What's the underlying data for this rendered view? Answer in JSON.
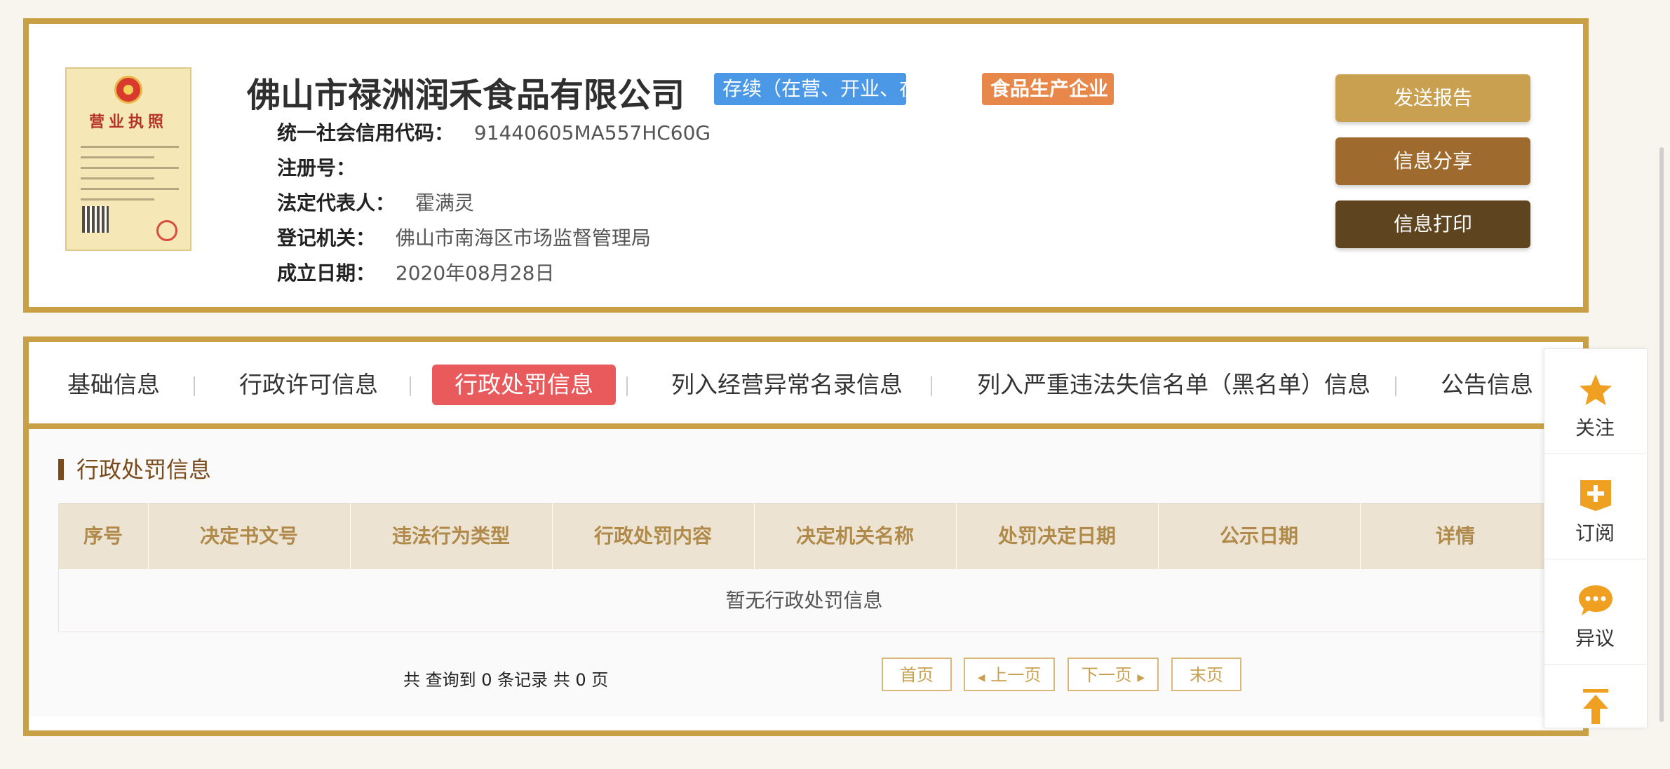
{
  "company": {
    "name": "佛山市禄洲润禾食品有限公司",
    "status_badge": "存续（在营、开业、在册）",
    "type_badge": "食品生产企业",
    "license_title": "营业执照",
    "fields": [
      {
        "label": "统一社会信用代码：",
        "value": "91440605MA557HC60G"
      },
      {
        "label": "注册号：",
        "value": ""
      },
      {
        "label": "法定代表人：",
        "value": "霍满灵"
      },
      {
        "label": "登记机关：",
        "value": "佛山市南海区市场监督管理局"
      },
      {
        "label": "成立日期：",
        "value": "2020年08月28日"
      }
    ]
  },
  "actions": {
    "send_report": "发送报告",
    "share": "信息分享",
    "print": "信息打印"
  },
  "tabs": [
    {
      "label": "基础信息",
      "active": false
    },
    {
      "label": "行政许可信息",
      "active": false
    },
    {
      "label": "行政处罚信息",
      "active": true
    },
    {
      "label": "列入经营异常名录信息",
      "active": false
    },
    {
      "label": "列入严重违法失信名单（黑名单）信息",
      "active": false
    },
    {
      "label": "公告信息",
      "active": false
    }
  ],
  "section": {
    "title": "行政处罚信息",
    "columns": [
      "序号",
      "决定书文号",
      "违法行为类型",
      "行政处罚内容",
      "决定机关名称",
      "处罚决定日期",
      "公示日期",
      "详情"
    ],
    "empty_text": "暂无行政处罚信息"
  },
  "pagination": {
    "summary": "共 查询到 0 条记录 共 0 页",
    "first": "首页",
    "prev": "上一页",
    "next": "下一页",
    "last": "末页"
  },
  "sidebar": [
    {
      "label": "关注",
      "icon": "star-icon"
    },
    {
      "label": "订阅",
      "icon": "subscribe-icon"
    },
    {
      "label": "异议",
      "icon": "chat-icon"
    },
    {
      "label": "",
      "icon": "back-to-top-icon"
    }
  ],
  "colors": {
    "gold": "#c9a046",
    "active_tab": "#e95a5c",
    "status_blue": "#4a98e6",
    "type_orange": "#e8874a"
  }
}
